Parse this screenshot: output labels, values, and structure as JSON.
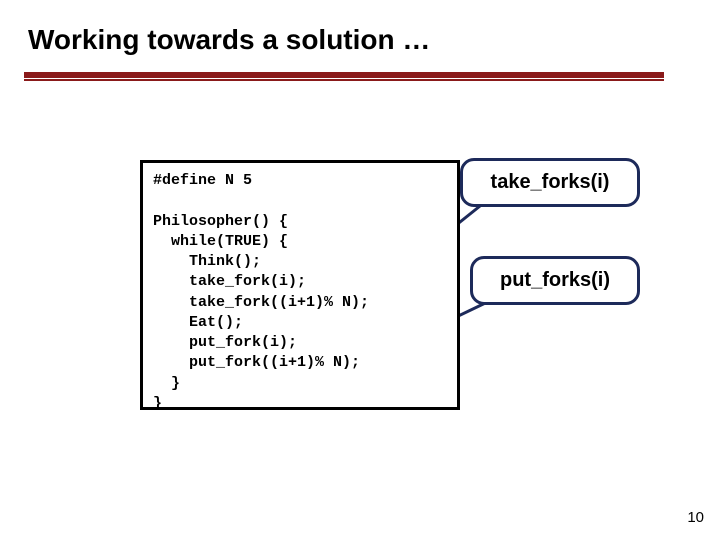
{
  "title": "Working towards a solution …",
  "code": {
    "l1": "#define N 5",
    "l2": "",
    "l3": "Philosopher() {",
    "l4": "  while(TRUE) {",
    "l5": "    Think();",
    "l6": "    take_fork(i);",
    "l7": "    take_fork((i+1)% N);",
    "l8": "    Eat();",
    "l9": "    put_fork(i);",
    "l10": "    put_fork((i+1)% N);",
    "l11": "  }",
    "l12": "}"
  },
  "callouts": {
    "take": "take_forks(i)",
    "put": "put_forks(i)"
  },
  "page_number": "10"
}
